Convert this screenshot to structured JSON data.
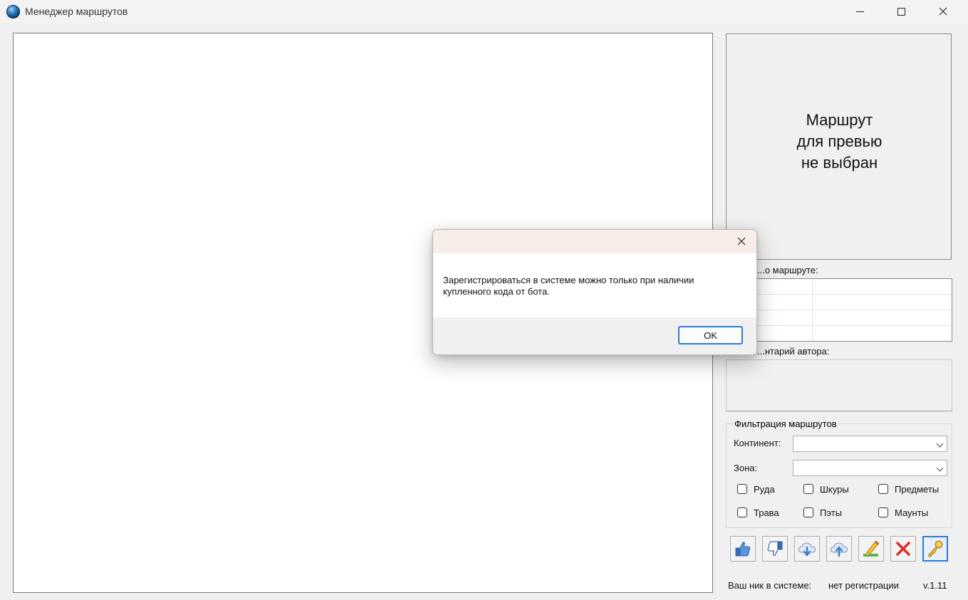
{
  "window": {
    "title": "Менеджер маршрутов"
  },
  "preview": {
    "line1": "Маршрут",
    "line2": "для превью",
    "line3": "не выбран"
  },
  "info": {
    "label": "...о маршруте:",
    "rows": 4
  },
  "comment": {
    "label": "...нтарий автора:"
  },
  "filter": {
    "title": "Фильтрация маршрутов",
    "continent_label": "Континент:",
    "continent_value": "",
    "zone_label": "Зона:",
    "zone_value": "",
    "checkboxes": [
      "Руда",
      "Шкуры",
      "Предметы",
      "Трава",
      "Пэты",
      "Маунты"
    ]
  },
  "toolbar": {
    "icons": [
      "thumbs-up-icon",
      "thumbs-down-icon",
      "cloud-download-icon",
      "cloud-upload-icon",
      "edit-pencil-icon",
      "delete-x-icon",
      "key-icon"
    ]
  },
  "status": {
    "nick_label": "Ваш ник в системе:",
    "nick_value": "нет регистрации",
    "version": "v.1.11"
  },
  "dialog": {
    "message_line1": "Зарегистрироваться в системе можно только при наличии",
    "message_line2": "купленного кода от бота.",
    "ok_label": "OK"
  },
  "colors": {
    "accent": "#2b7bd6",
    "dialog_header": "#f7eee9",
    "window_bg": "#f0f0f0"
  }
}
